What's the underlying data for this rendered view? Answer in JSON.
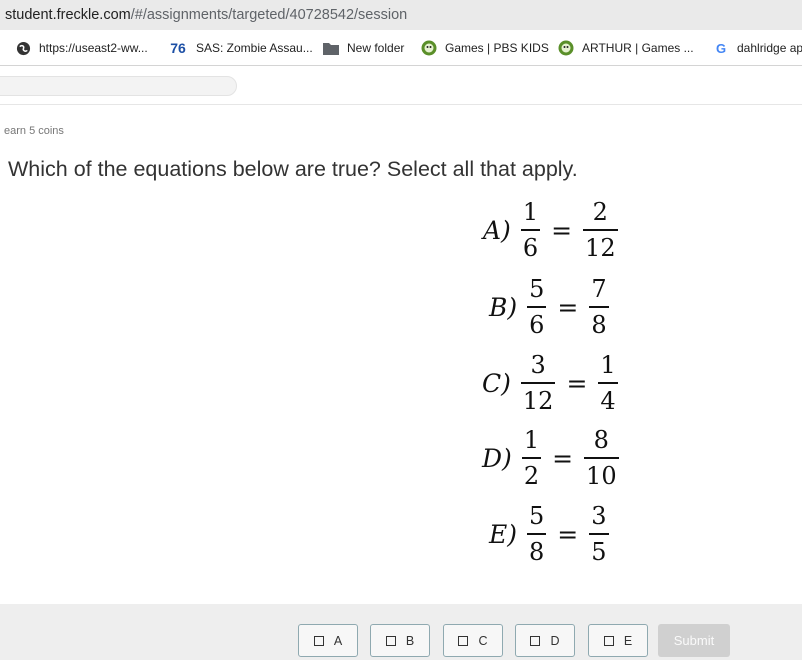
{
  "browser": {
    "url_host": "student.freckle.com",
    "url_path": "/#/assignments/targeted/40728542/session",
    "bookmarks": [
      {
        "label": "https://useast2-ww...",
        "icon": "globe-icon"
      },
      {
        "label": "SAS: Zombie Assau...",
        "badge": "76",
        "icon": "sas-76-icon"
      },
      {
        "label": "New folder",
        "icon": "folder-icon"
      },
      {
        "label": "Games | PBS KIDS",
        "icon": "pbs-kids-icon"
      },
      {
        "label": "ARTHUR | Games ...",
        "icon": "pbs-kids-icon"
      },
      {
        "label": "dahlridge ap",
        "icon": "google-icon"
      }
    ]
  },
  "colors": {
    "choice_border": "#8fa9b0",
    "submit_disabled": "#d0d0d0",
    "footer_bg": "#eeeeee"
  },
  "coins_text": "earn 5 coins",
  "question": "Which of the equations below are true? Select all that apply.",
  "equations": [
    {
      "label": "A)",
      "left": {
        "num": "1",
        "den": "6"
      },
      "sign": "=",
      "right": {
        "num": "2",
        "den": "12"
      }
    },
    {
      "label": "B)",
      "left": {
        "num": "5",
        "den": "6"
      },
      "sign": "=",
      "right": {
        "num": "7",
        "den": "8"
      }
    },
    {
      "label": "C)",
      "left": {
        "num": "3",
        "den": "12"
      },
      "sign": "=",
      "right": {
        "num": "1",
        "den": "4"
      }
    },
    {
      "label": "D)",
      "left": {
        "num": "1",
        "den": "2"
      },
      "sign": "=",
      "right": {
        "num": "8",
        "den": "10"
      }
    },
    {
      "label": "E)",
      "left": {
        "num": "5",
        "den": "8"
      },
      "sign": "=",
      "right": {
        "num": "3",
        "den": "5"
      }
    }
  ],
  "choices": [
    "A",
    "B",
    "C",
    "D",
    "E"
  ],
  "submit_label": "Submit"
}
